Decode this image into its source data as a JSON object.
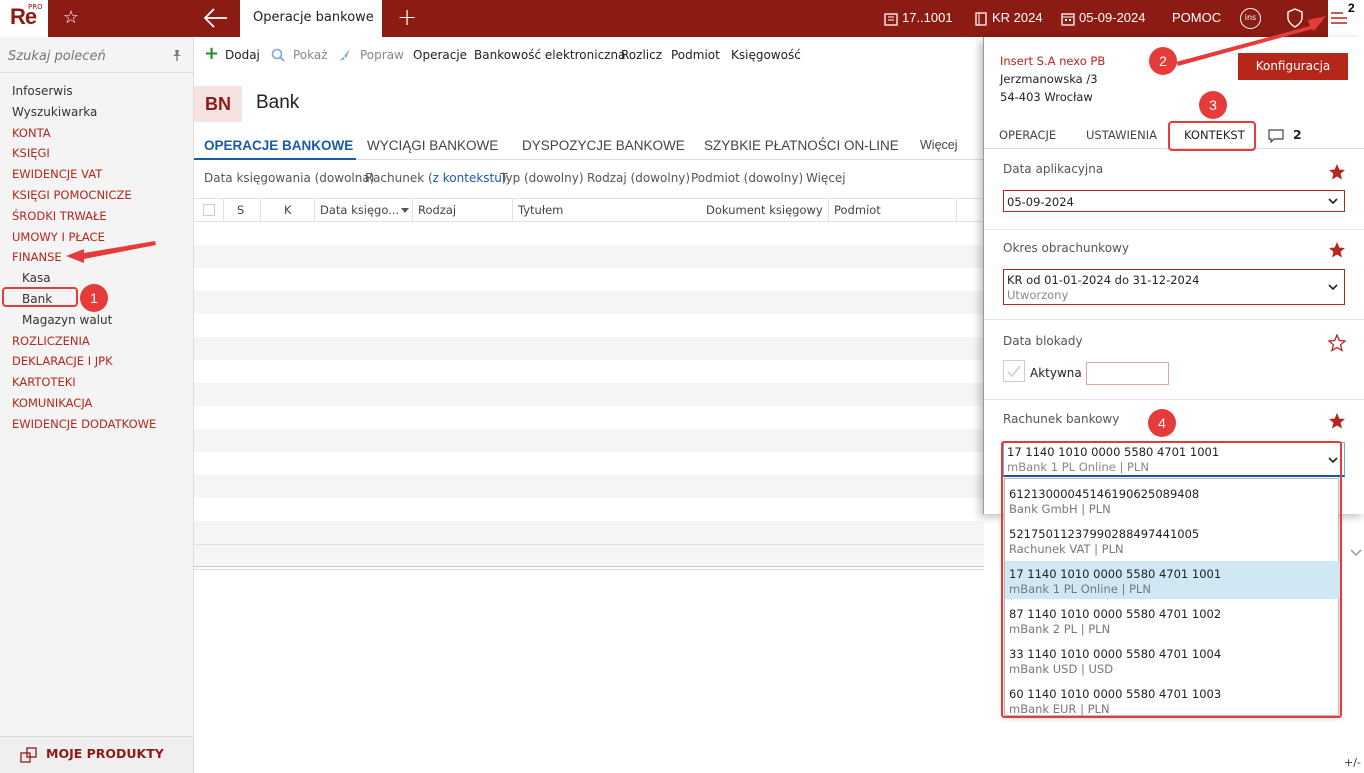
{
  "app": {
    "logo": "Re",
    "logo_badge": "PRO"
  },
  "topbar": {
    "active_tab": "Operacje bankowe",
    "company_code": "17..1001",
    "period": "KR 2024",
    "date": "05-09-2024",
    "help": "POMOC",
    "ins_label": "ins",
    "menu_badge": "2"
  },
  "sidebar": {
    "search_placeholder": "Szukaj poleceń",
    "items": [
      {
        "label": "Infoserwis"
      },
      {
        "label": "Wyszukiwarka"
      },
      {
        "label": "KONTA"
      },
      {
        "label": "KSIĘGI"
      },
      {
        "label": "EWIDENCJE VAT"
      },
      {
        "label": "KSIĘGI POMOCNICZE"
      },
      {
        "label": "ŚRODKI TRWAŁE"
      },
      {
        "label": "UMOWY I PŁACE"
      },
      {
        "label": "FINANSE"
      },
      {
        "label": "Kasa"
      },
      {
        "label": "Bank"
      },
      {
        "label": "Magazyn walut"
      },
      {
        "label": "ROZLICZENIA"
      },
      {
        "label": "DEKLARACJE I JPK"
      },
      {
        "label": "KARTOTEKI"
      },
      {
        "label": "KOMUNIKACJA"
      },
      {
        "label": "EWIDENCJE DODATKOWE"
      }
    ],
    "bottom_label": "MOJE PRODUKTY"
  },
  "toolbar": {
    "add": "Dodaj",
    "show": "Pokaż",
    "edit": "Popraw",
    "operations": "Operacje",
    "ebanking": "Bankowość elektroniczna",
    "settle": "Rozlicz",
    "subject": "Podmiot",
    "accounting": "Księgowość"
  },
  "page": {
    "badge": "BN",
    "title": "Bank"
  },
  "tabs": [
    {
      "label": "OPERACJE BANKOWE"
    },
    {
      "label": "WYCIĄGI BANKOWE"
    },
    {
      "label": "DYSPOZYCJE BANKOWE"
    },
    {
      "label": "SZYBKIE PŁATNOŚCI ON-LINE"
    },
    {
      "label": "Więcej"
    }
  ],
  "filters": {
    "date": "Data księgowania (dowolna)",
    "account_prefix": "Rachunek (",
    "account_link": "z kontekstu",
    "account_suffix": ")",
    "type": "Typ (dowolny)",
    "kind": "Rodzaj (dowolny)",
    "subject": "Podmiot (dowolny)",
    "more": "Więcej"
  },
  "grid": {
    "columns": {
      "s": "S",
      "k": "K",
      "date": "Data księgo...",
      "kind": "Rodzaj",
      "title": "Tytułem",
      "doc": "Dokument księgowy",
      "subject": "Podmiot"
    }
  },
  "panel": {
    "company_name": "Insert S.A nexo PB",
    "address1": "Jerzmanowska /3",
    "address2": "54-403 Wrocław",
    "config_button": "Konfiguracja",
    "tabs": {
      "operations": "OPERACJE",
      "settings": "USTAWIENIA",
      "context": "KONTEKST",
      "messages_count": "2"
    },
    "app_date": {
      "label": "Data aplikacyjna",
      "value": "05-09-2024"
    },
    "period": {
      "label": "Okres obrachunkowy",
      "value": "KR od 01-01-2024 do 31-12-2024",
      "status": "Utworzony"
    },
    "lock_date": {
      "label": "Data blokady",
      "checkbox_label": "Aktywna"
    },
    "bank_account": {
      "label": "Rachunek bankowy",
      "value": "17 1140 1010 0000 5580 4701 1001",
      "desc": "mBank 1 PL Online | PLN"
    }
  },
  "dropdown": [
    {
      "number": "61213000045146190625089408",
      "desc": "Bank GmbH | PLN",
      "selected": false
    },
    {
      "number": "52175011237990288497441005",
      "desc": "Rachunek VAT | PLN",
      "selected": false
    },
    {
      "number": "17 1140 1010 0000 5580 4701 1001",
      "desc": "mBank 1 PL Online | PLN",
      "selected": true
    },
    {
      "number": "87 1140 1010 0000 5580 4701 1002",
      "desc": "mBank 2 PL | PLN",
      "selected": false
    },
    {
      "number": " 33 1140 1010 0000 5580 4701 1004",
      "desc": "mBank USD | USD",
      "selected": false
    },
    {
      "number": "60 1140 1010 0000 5580 4701 1003",
      "desc": "mBank EUR | PLN",
      "selected": false
    }
  ],
  "annotations": {
    "step1": "1",
    "step2": "2",
    "step3": "3",
    "step4": "4"
  },
  "footer": {
    "plusminus": "+/-"
  },
  "colors": {
    "brand": "#8c1b14",
    "accent_red": "#b5261b",
    "annotation": "#e63b3b",
    "link": "#1a5aa8",
    "selected_row": "#cfe8f3"
  }
}
